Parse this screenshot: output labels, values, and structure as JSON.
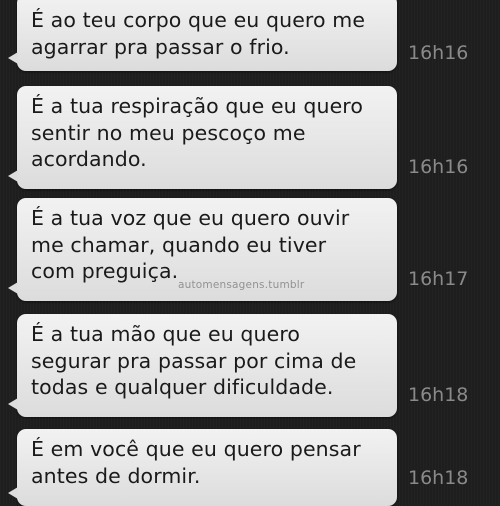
{
  "messages": [
    {
      "text": "É ao teu corpo que eu quero me\nagarrar pra passar o frio.",
      "time": "16h16"
    },
    {
      "text": "É a tua respiração que eu quero\nsentir no meu pescoço me\nacordando.",
      "time": "16h16"
    },
    {
      "text": "É a tua voz que eu quero ouvir\nme chamar, quando eu tiver\ncom preguiça.",
      "time": "16h17"
    },
    {
      "text": "É a tua mão que eu quero\nsegurar pra passar por cima de\ntodas e qualquer dificuldade.",
      "time": "16h18"
    },
    {
      "text": "É em você que eu quero pensar\nantes de dormir.",
      "time": "16h18"
    }
  ],
  "watermark": "automensagens.tumblr",
  "colors": {
    "background": "#1e1e1e",
    "bubble": "#e6e6e6",
    "text": "#1a1a1a",
    "time": "#8a8a8a"
  }
}
